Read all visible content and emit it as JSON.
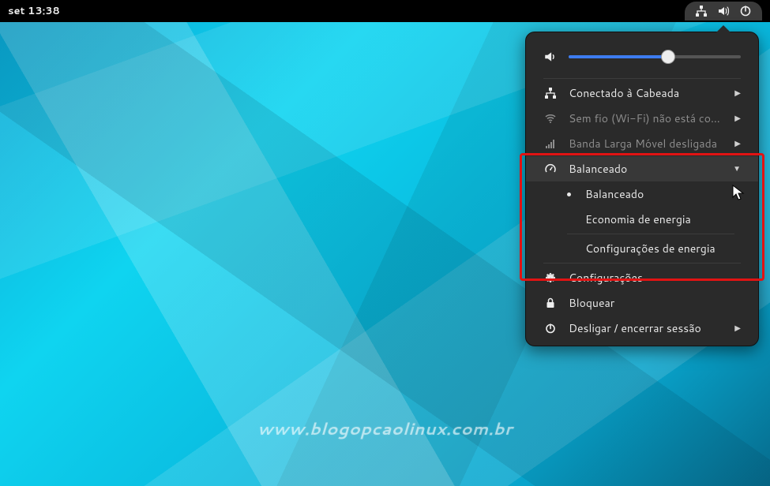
{
  "topbar": {
    "datetime": "set  13:38"
  },
  "volume": {
    "level_percent": 58
  },
  "menu": {
    "wired": "Conectado à Cabeada",
    "wifi": "Sem fio (Wi-Fi) não está con…",
    "mobile": "Banda Larga Móvel desligada",
    "power_mode_header": "Balanceado",
    "power_modes": {
      "balanced": "Balanceado",
      "saver": "Economia de energia"
    },
    "power_settings": "Configurações de energia",
    "settings": "Configurações",
    "lock": "Bloquear",
    "power": "Desligar / encerrar sessão"
  },
  "watermark": "www.blogopcaolinux.com.br"
}
